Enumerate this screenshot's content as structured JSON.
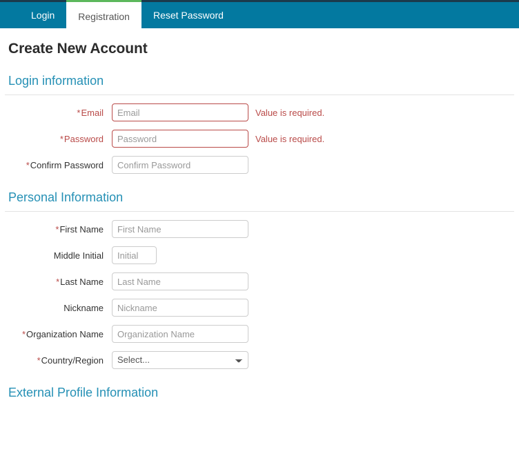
{
  "theme": {
    "tab_bar_color": "#0379a0",
    "top_strip_color": "#1b3a4b",
    "active_tab_accent": "#5cb85c",
    "section_heading_color": "#2590b5",
    "error_color": "#b94a48",
    "input_border_color": "#cccccc",
    "placeholder_color": "#999999"
  },
  "tabs": [
    {
      "label": "Login",
      "active": false
    },
    {
      "label": "Registration",
      "active": true
    },
    {
      "label": "Reset Password",
      "active": false
    }
  ],
  "page": {
    "title": "Create New Account"
  },
  "sections": [
    {
      "heading": "Login information",
      "fields": [
        {
          "label": "Email",
          "required": true,
          "placeholder": "Email",
          "value": "",
          "error": "Value is required.",
          "type": "text"
        },
        {
          "label": "Password",
          "required": true,
          "placeholder": "Password",
          "value": "",
          "error": "Value is required.",
          "type": "password"
        },
        {
          "label": "Confirm Password",
          "required": true,
          "placeholder": "Confirm Password",
          "value": "",
          "error": "",
          "type": "password"
        }
      ]
    },
    {
      "heading": "Personal Information",
      "fields": [
        {
          "label": "First Name",
          "required": true,
          "placeholder": "First Name",
          "value": "",
          "error": "",
          "type": "text"
        },
        {
          "label": "Middle Initial",
          "required": false,
          "placeholder": "Initial",
          "value": "",
          "error": "",
          "type": "text"
        },
        {
          "label": "Last Name",
          "required": true,
          "placeholder": "Last Name",
          "value": "",
          "error": "",
          "type": "text"
        },
        {
          "label": "Nickname",
          "required": false,
          "placeholder": "Nickname",
          "value": "",
          "error": "",
          "type": "text"
        },
        {
          "label": "Organization Name",
          "required": true,
          "placeholder": "Organization Name",
          "value": "",
          "error": "",
          "type": "text"
        },
        {
          "label": "Country/Region",
          "required": true,
          "placeholder": "",
          "value": "Select...",
          "error": "",
          "type": "select",
          "options": [
            "Select..."
          ]
        }
      ]
    },
    {
      "heading": "External Profile Information",
      "fields": []
    }
  ]
}
